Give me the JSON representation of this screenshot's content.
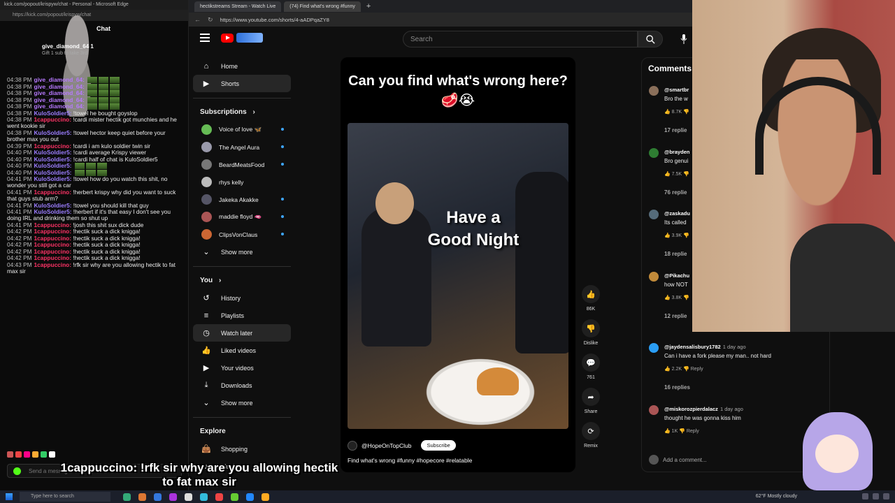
{
  "chat_window": {
    "title": "kick.com/popout/krispyw/chat - Personal - Microsoft Edge",
    "url": "https://kick.com/popout/krispyw/chat",
    "header": "Chat",
    "gift": {
      "user": "give_diamond_64",
      "count": "1",
      "text": "Gift 1 sub to take 3rd"
    },
    "messages": [
      {
        "time": "04:38 PM",
        "user": "give_diamond_64:",
        "text": "",
        "cls": "u1"
      },
      {
        "time": "04:38 PM",
        "user": "give_diamond_64:",
        "text": "",
        "cls": "u1"
      },
      {
        "time": "04:38 PM",
        "user": "give_diamond_64:",
        "text": "",
        "cls": "u1"
      },
      {
        "time": "04:38 PM",
        "user": "give_diamond_64:",
        "text": "",
        "cls": "u1"
      },
      {
        "time": "04:38 PM",
        "user": "give_diamond_64:",
        "text": "",
        "cls": "u1"
      },
      {
        "time": "04:38 PM",
        "user": "KuloSoldier5:",
        "text": "!towel he bought goyslop",
        "cls": "u3"
      },
      {
        "time": "04:38 PM",
        "user": "1cappuccino:",
        "text": "!cardi mister hectik got munchies and he went kookie sir",
        "cls": "u2"
      },
      {
        "time": "04:38 PM",
        "user": "KuloSoldier5:",
        "text": "!towel hector keep quiet before your brother max you out",
        "cls": "u3"
      },
      {
        "time": "04:39 PM",
        "user": "1cappuccino:",
        "text": "!cardi i am kulo soldier twin sir",
        "cls": "u2"
      },
      {
        "time": "04:40 PM",
        "user": "KuloSoldier5:",
        "text": "!cardi average Krispy viewer",
        "cls": "u3"
      },
      {
        "time": "04:40 PM",
        "user": "KuloSoldier5:",
        "text": "!cardi half of chat is KuloSoldier5",
        "cls": "u3"
      },
      {
        "time": "04:40 PM",
        "user": "KuloSoldier5:",
        "text": "",
        "cls": "u3"
      },
      {
        "time": "04:40 PM",
        "user": "KuloSoldier5:",
        "text": "",
        "cls": "u3"
      },
      {
        "time": "04:41 PM",
        "user": "KuloSoldier5:",
        "text": "!towel how do you watch this shit, no wonder you still got a car",
        "cls": "u3"
      },
      {
        "time": "04:41 PM",
        "user": "1cappuccino:",
        "text": "!herbert krispy why did you want to suck that guys stub arm?",
        "cls": "u2"
      },
      {
        "time": "04:41 PM",
        "user": "KuloSoldier5:",
        "text": "!towel you should kill that guy",
        "cls": "u3"
      },
      {
        "time": "04:41 PM",
        "user": "KuloSoldier5:",
        "text": "!herbert if it's that easy I don't see you doing IRL and drinking them so shut up",
        "cls": "u3"
      },
      {
        "time": "04:41 PM",
        "user": "1cappuccino:",
        "text": "!josh this shit sux dick dude",
        "cls": "u2"
      },
      {
        "time": "04:42 PM",
        "user": "1cappuccino:",
        "text": "!hectik suck a dick knigga!",
        "cls": "u2"
      },
      {
        "time": "04:42 PM",
        "user": "1cappuccino:",
        "text": "!hectik suck a dick knigga!",
        "cls": "u2"
      },
      {
        "time": "04:42 PM",
        "user": "1cappuccino:",
        "text": "!hectik suck a dick knigga!",
        "cls": "u2"
      },
      {
        "time": "04:42 PM",
        "user": "1cappuccino:",
        "text": "!hectik suck a dick knigga!",
        "cls": "u2"
      },
      {
        "time": "04:42 PM",
        "user": "1cappuccino:",
        "text": "!hectik suck a dick knigga!",
        "cls": "u2"
      },
      {
        "time": "04:43 PM",
        "user": "1cappuccino:",
        "text": "!rfk sir why are you allowing hectik to fat max sir",
        "cls": "u2"
      }
    ],
    "input_placeholder": "Send a message"
  },
  "caption": "1cappuccino: !rfk sir why are you allowing hectik to fat max sir",
  "browser": {
    "tabs": [
      {
        "label": "hectikstreams Stream - Watch Live"
      },
      {
        "label": "(74) Find what's wrong #funny"
      }
    ],
    "url": "https://www.youtube.com/shorts/4-aADPqaZY8",
    "status_url": "https://www.youtube.com/feed/playlists"
  },
  "youtube": {
    "search_placeholder": "Search",
    "nav": [
      {
        "label": "Home",
        "icon": "home-icon",
        "glyph": "⌂"
      },
      {
        "label": "Shorts",
        "icon": "shorts-icon",
        "glyph": "▶"
      }
    ],
    "subscriptions_label": "Subscriptions",
    "subscriptions_arrow": "›",
    "subs": [
      {
        "label": "Voice of love 🦋"
      },
      {
        "label": "The Angel Aura"
      },
      {
        "label": "BeardMeatsFood"
      },
      {
        "label": "rhys kelly"
      },
      {
        "label": "Jakeka Akakke"
      },
      {
        "label": "maddie floyd 🫦"
      },
      {
        "label": "ClipsVonClaus"
      }
    ],
    "show_more": "Show more",
    "you_label": "You",
    "you_arrow": "›",
    "you_items": [
      {
        "label": "History",
        "glyph": "↺"
      },
      {
        "label": "Playlists",
        "glyph": "≡"
      },
      {
        "label": "Watch later",
        "glyph": "◷"
      },
      {
        "label": "Liked videos",
        "glyph": "👍"
      },
      {
        "label": "Your videos",
        "glyph": "▶"
      },
      {
        "label": "Downloads",
        "glyph": "⤓"
      }
    ],
    "show_more_2": "Show more",
    "explore_label": "Explore",
    "explore_items": [
      {
        "label": "Shopping",
        "glyph": "👜"
      },
      {
        "label": "Music",
        "glyph": "♪"
      }
    ],
    "short": {
      "title": "Can you find what's wrong here? 🥩😭",
      "overlay_text": "Have a Good Night",
      "channel": "@HopeOnTopClub",
      "subscribe": "Subscribe",
      "description": "Find what's wrong #funny #hopecore #relatable"
    },
    "actions": [
      {
        "label": "86K",
        "glyph": "👍"
      },
      {
        "label": "Dislike",
        "glyph": "👎"
      },
      {
        "label": "761",
        "glyph": "💬"
      },
      {
        "label": "Share",
        "glyph": "➦"
      },
      {
        "label": "Remix",
        "glyph": "⟳"
      }
    ],
    "comments": {
      "header": "Comments",
      "items": [
        {
          "user": "@smartbr",
          "time": "",
          "text": "Bro the w",
          "likes": "8.7K",
          "replies": "17 replie"
        },
        {
          "user": "@brayden",
          "time": "",
          "text": "Bro genui",
          "likes": "7.5K",
          "replies": "76 replie"
        },
        {
          "user": "@zaskadu",
          "time": "",
          "text": "Its called",
          "likes": "3.9K",
          "replies": "18 replie"
        },
        {
          "user": "@Pikachu",
          "time": "",
          "text": "how NOT",
          "likes": "3.8K",
          "replies": "12 replie"
        },
        {
          "user": "@jaydensalisbury1782",
          "time": "1 day ago",
          "text": "Can i have a fork please my man.. not hard",
          "likes": "2.2K",
          "reply": "Reply",
          "replies": "16 replies"
        },
        {
          "user": "@miskorozpierdalacz",
          "time": "1 day ago",
          "text": "thought he was gonna kiss him",
          "likes": "1K",
          "reply": "Reply",
          "replies": ""
        }
      ],
      "add_placeholder": "Add a comment..."
    }
  },
  "taskbar": {
    "search": "Type here to search",
    "weather": "62°F Mostly cloudy"
  }
}
